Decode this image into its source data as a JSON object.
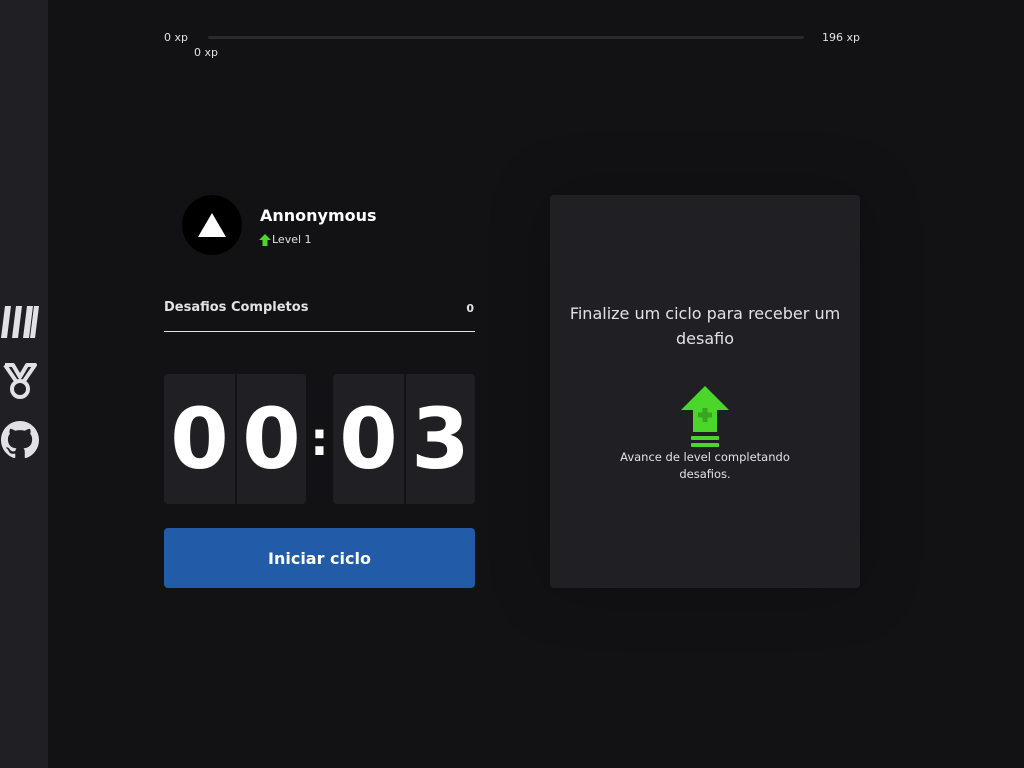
{
  "sidebar": {
    "items": [
      {
        "icon": "logo-icon"
      },
      {
        "icon": "medal-icon"
      },
      {
        "icon": "github-icon"
      }
    ]
  },
  "xp": {
    "min_label": "0 xp",
    "max_label": "196 xp",
    "current_label": "0 xp",
    "progress": 0
  },
  "profile": {
    "name": "Annonymous",
    "level_label": "Level 1",
    "avatar_icon": "triangle-icon"
  },
  "completed_challenges": {
    "label": "Desafios Completos",
    "count": "0"
  },
  "countdown": {
    "minutes": [
      "0",
      "0"
    ],
    "separator": ":",
    "seconds": [
      "0",
      "3"
    ]
  },
  "start_button": {
    "label": "Iniciar ciclo"
  },
  "challenge": {
    "title": "Finalize um ciclo para receber um desafio",
    "icon": "level-up-icon",
    "description": "Avance de level completando desafios."
  },
  "colors": {
    "background": "#121214",
    "sidebar": "#202024",
    "accent_green": "#4cd62b",
    "button_blue": "#225ba7",
    "text": "#e1e1e6"
  }
}
